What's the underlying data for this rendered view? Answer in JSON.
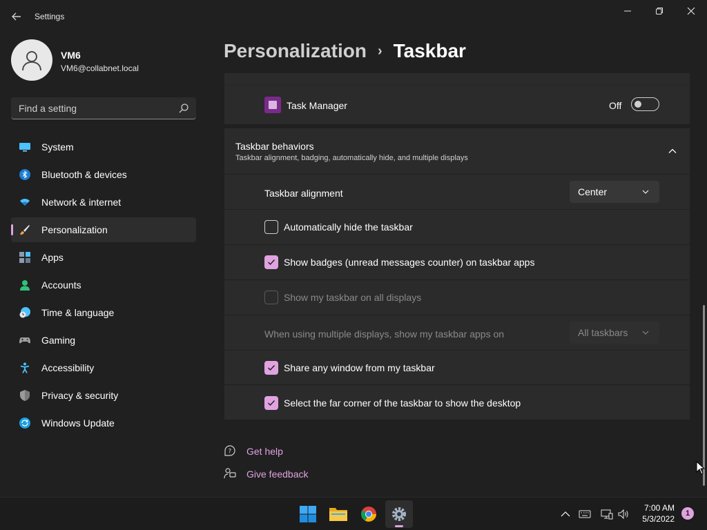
{
  "window": {
    "title": "Settings"
  },
  "user": {
    "name": "VM6",
    "email": "VM6@collabnet.local"
  },
  "search": {
    "placeholder": "Find a setting"
  },
  "sidebar": {
    "items": [
      {
        "label": "System",
        "icon": "monitor-icon"
      },
      {
        "label": "Bluetooth & devices",
        "icon": "bluetooth-icon"
      },
      {
        "label": "Network & internet",
        "icon": "wifi-icon"
      },
      {
        "label": "Personalization",
        "icon": "brush-icon",
        "selected": true
      },
      {
        "label": "Apps",
        "icon": "apps-icon"
      },
      {
        "label": "Accounts",
        "icon": "person-icon"
      },
      {
        "label": "Time & language",
        "icon": "clock-globe-icon"
      },
      {
        "label": "Gaming",
        "icon": "gamepad-icon"
      },
      {
        "label": "Accessibility",
        "icon": "accessibility-icon"
      },
      {
        "label": "Privacy & security",
        "icon": "shield-icon"
      },
      {
        "label": "Windows Update",
        "icon": "update-icon"
      }
    ]
  },
  "breadcrumb": {
    "parent": "Personalization",
    "separator": "›",
    "current": "Taskbar"
  },
  "task_manager": {
    "label": "Task Manager",
    "toggle_state": "Off"
  },
  "behaviors": {
    "title": "Taskbar behaviors",
    "subtitle": "Taskbar alignment, badging, automatically hide, and multiple displays",
    "alignment_label": "Taskbar alignment",
    "alignment_value": "Center",
    "auto_hide_label": "Automatically hide the taskbar",
    "auto_hide_checked": false,
    "badges_label": "Show badges (unread messages counter) on taskbar apps",
    "badges_checked": true,
    "all_displays_label": "Show my taskbar on all displays",
    "all_displays_checked": false,
    "multi_display_label": "When using multiple displays, show my taskbar apps on",
    "multi_display_value": "All taskbars",
    "share_window_label": "Share any window from my taskbar",
    "share_window_checked": true,
    "far_corner_label": "Select the far corner of the taskbar to show the desktop",
    "far_corner_checked": true
  },
  "links": {
    "help": "Get help",
    "feedback": "Give feedback"
  },
  "taskbar": {
    "time": "7:00 AM",
    "date": "5/3/2022",
    "notifications": "1"
  },
  "colors": {
    "accent": "#e0a3e0",
    "background": "#202020",
    "card": "#2b2b2b"
  }
}
